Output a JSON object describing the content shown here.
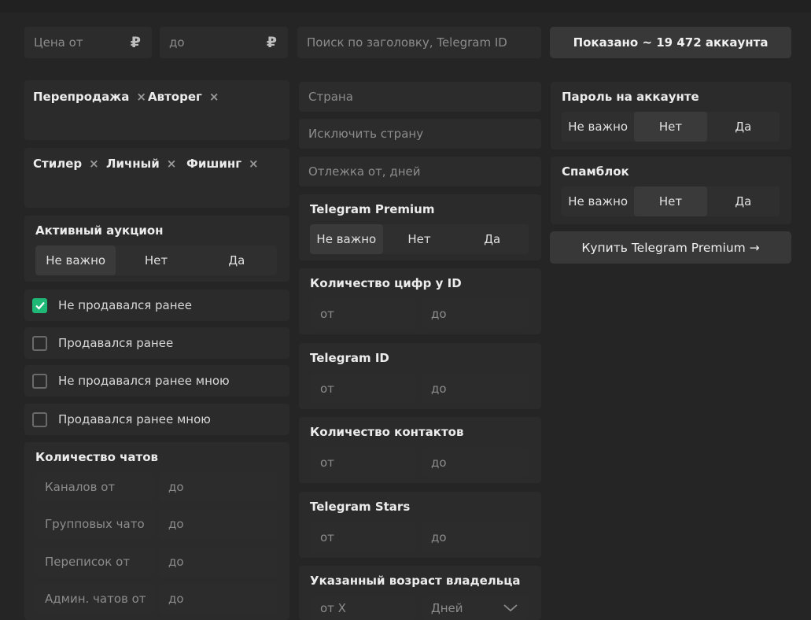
{
  "top": {
    "price_from_placeholder": "Цена от",
    "price_to_placeholder": "до",
    "currency_symbol": "₽",
    "search_placeholder": "Поиск по заголовку, Telegram ID",
    "shown_button": "Показано ~ 19 472 аккаунта"
  },
  "col1": {
    "chips_row1": [
      "Перепродажа",
      "Авторег"
    ],
    "chips_row2": [
      "Стилер",
      "Личный",
      "Фишинг"
    ],
    "chip_remove": "×",
    "auction": {
      "title": "Активный аукцион",
      "options": [
        "Не важно",
        "Нет",
        "Да"
      ]
    },
    "checkboxes": [
      {
        "label": "Не продавался ранее",
        "checked": true
      },
      {
        "label": "Продавался ранее",
        "checked": false
      },
      {
        "label": "Не продавался ранее мною",
        "checked": false
      },
      {
        "label": "Продавался ранее мною",
        "checked": false
      }
    ],
    "chats": {
      "title": "Количество чатов",
      "rows": [
        {
          "from": "Каналов от",
          "to": "до"
        },
        {
          "from": "Групповых чато",
          "to": "до"
        },
        {
          "from": "Переписок от",
          "to": "до"
        },
        {
          "from": "Админ. чатов от",
          "to": "до"
        }
      ]
    }
  },
  "col2": {
    "country_placeholder": "Страна",
    "exclude_country_placeholder": "Исключить страну",
    "rest_placeholder": "Отлежка от, дней",
    "premium": {
      "title": "Telegram Premium",
      "options": [
        "Не важно",
        "Нет",
        "Да"
      ]
    },
    "digits": {
      "title": "Количество цифр у ID",
      "from": "от",
      "to": "до"
    },
    "tgid": {
      "title": "Telegram ID",
      "from": "от",
      "to": "до"
    },
    "contacts": {
      "title": "Количество контактов",
      "from": "от",
      "to": "до"
    },
    "stars": {
      "title": "Telegram Stars",
      "from": "от",
      "to": "до"
    },
    "age": {
      "title": "Указанный возраст владельца",
      "from": "от X",
      "unit": "Дней"
    }
  },
  "col3": {
    "password": {
      "title": "Пароль на аккаунте",
      "options": [
        "Не важно",
        "Нет",
        "Да"
      ]
    },
    "spamblock": {
      "title": "Спамблок",
      "options": [
        "Не важно",
        "Нет",
        "Да"
      ]
    },
    "buy_premium_button": "Купить Telegram Premium →"
  },
  "colors": {
    "background": "#252525",
    "panel": "#2b2b2b",
    "field": "#2c2c2c",
    "button": "#383838",
    "accent_green": "#1fb877"
  }
}
